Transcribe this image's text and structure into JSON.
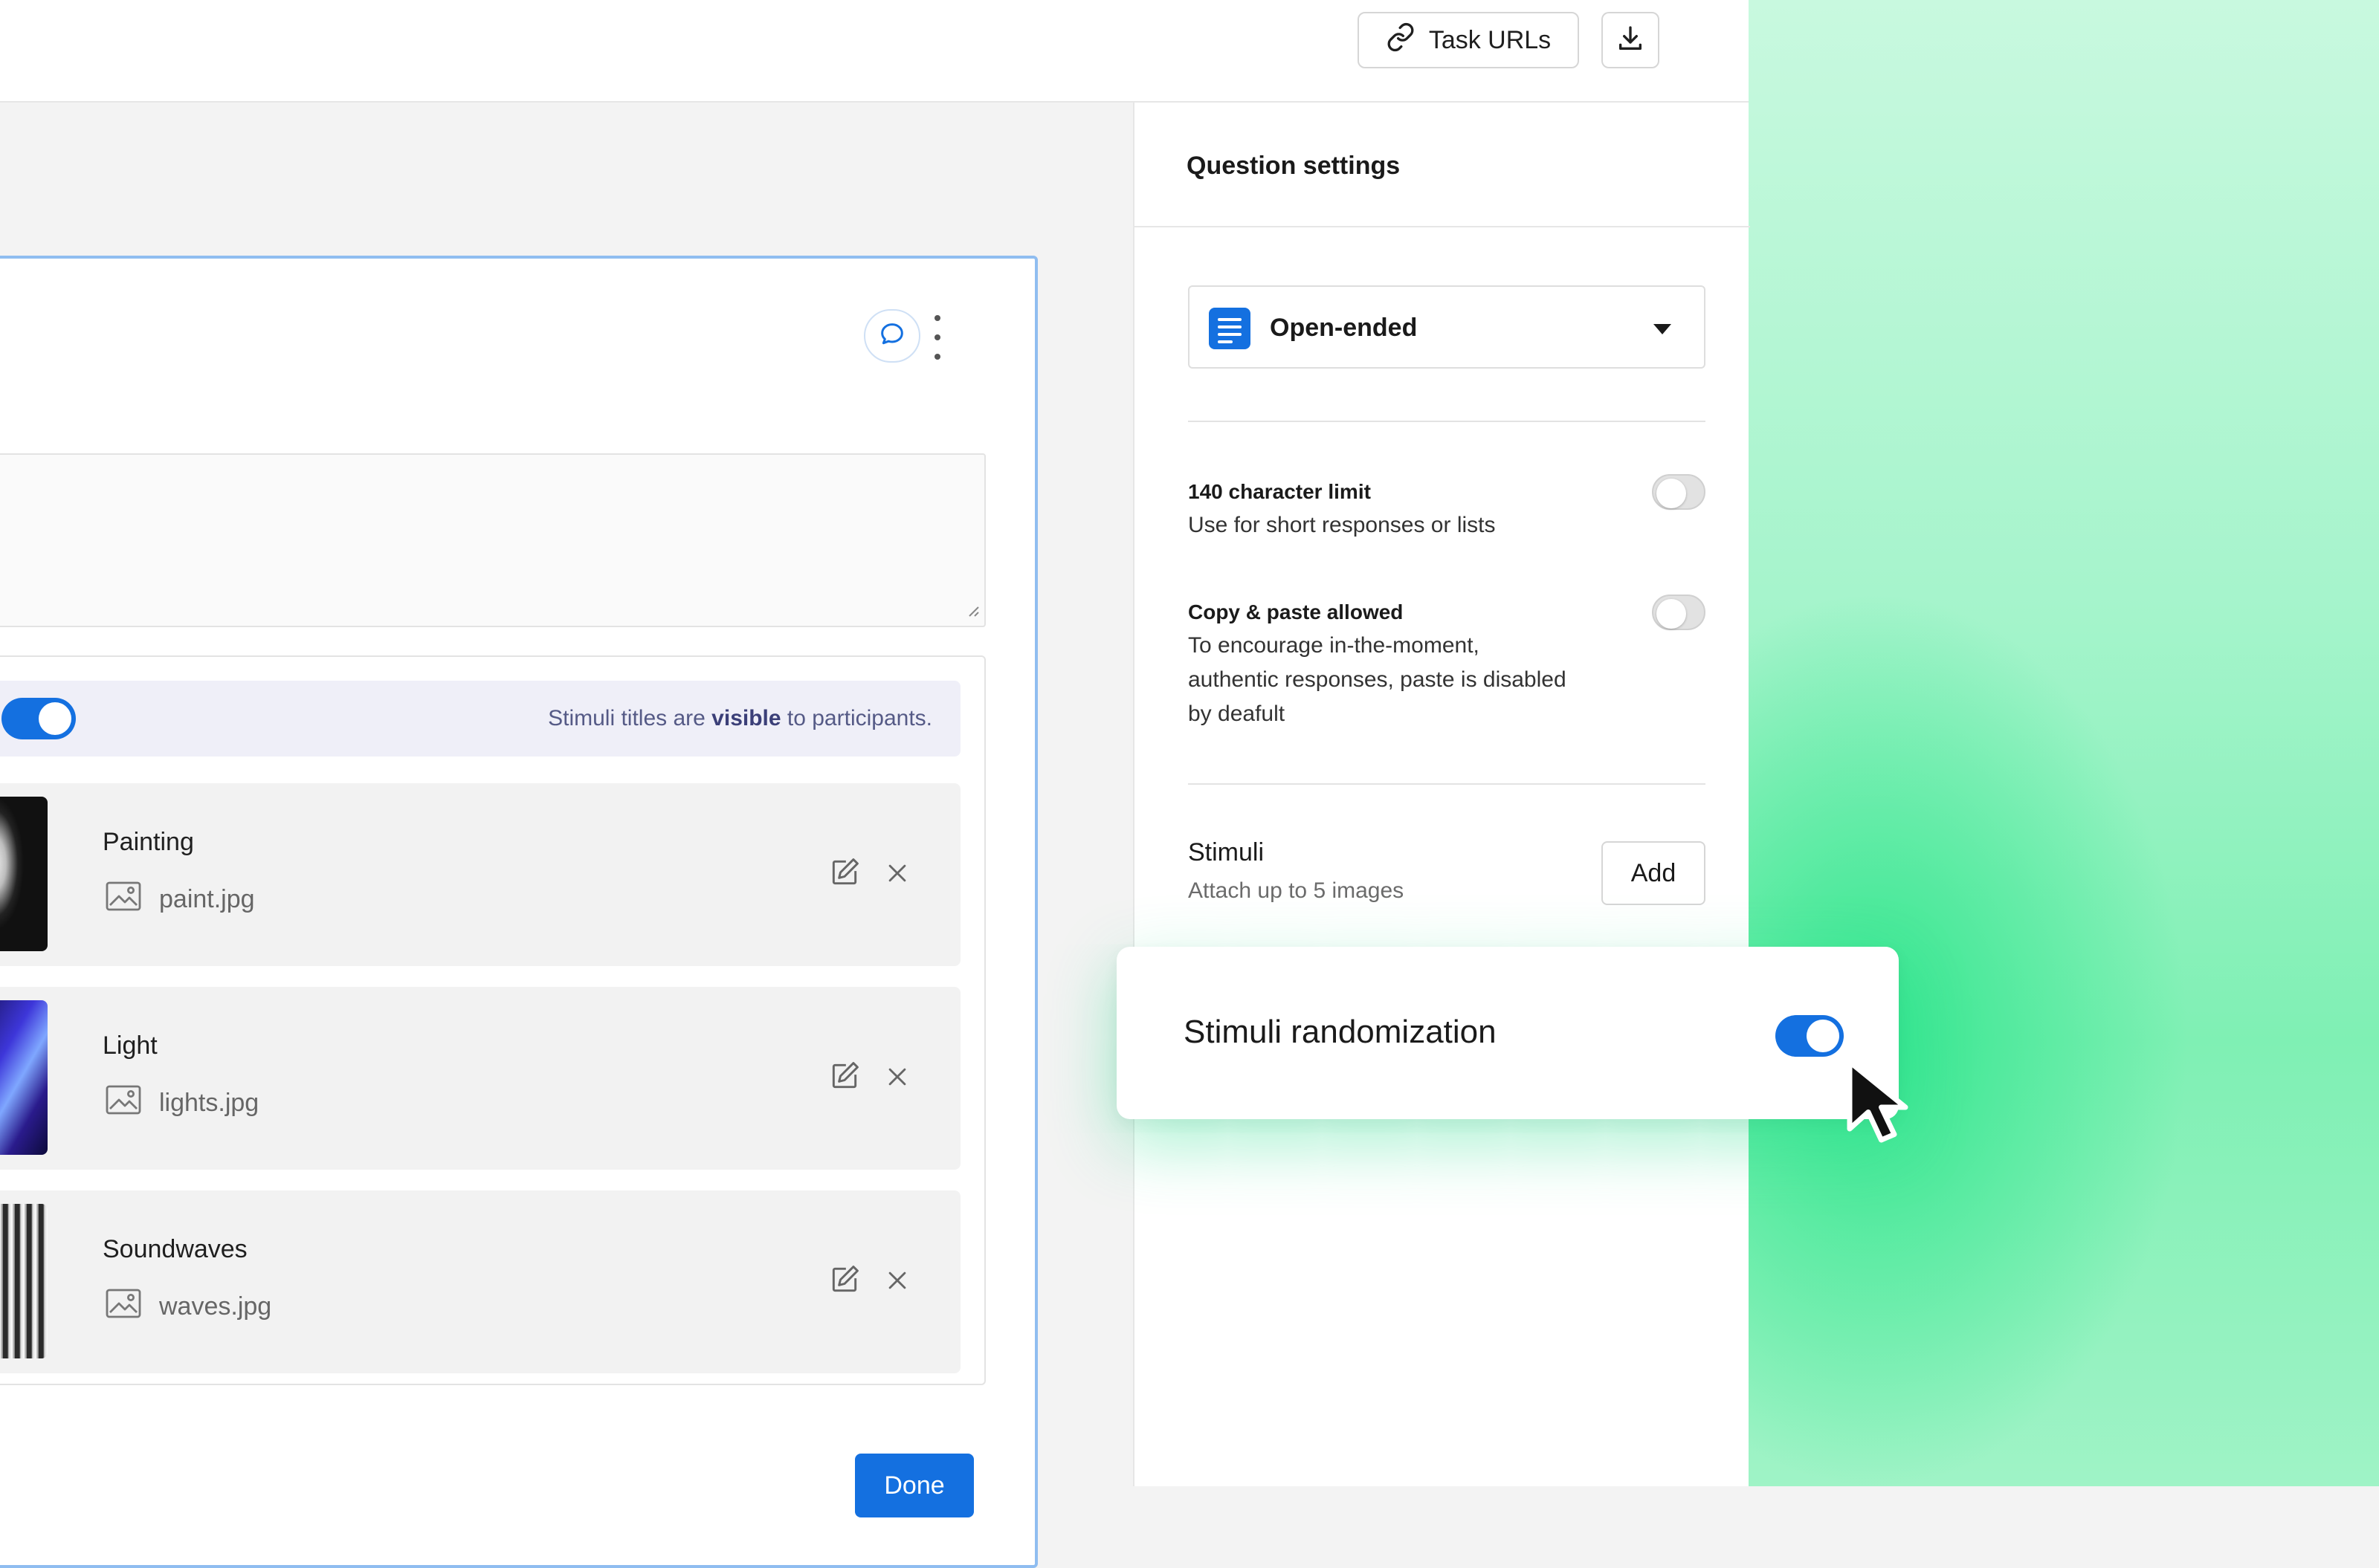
{
  "header": {
    "task_urls_label": "Task URLs"
  },
  "question_card": {
    "stimuli_visibility_text_1": "Stimuli titles are ",
    "stimuli_visibility_bold": "visible",
    "stimuli_visibility_text_2": " to participants.",
    "stimuli_visibility_toggle_on": true,
    "stimuli": [
      {
        "title": "Painting",
        "file": "paint.jpg"
      },
      {
        "title": "Light",
        "file": "lights.jpg"
      },
      {
        "title": "Soundwaves",
        "file": "waves.jpg"
      }
    ],
    "done_label": "Done"
  },
  "settings": {
    "title": "Question settings",
    "question_type": "Open-ended",
    "char_limit": {
      "title": "140 character limit",
      "desc": "Use for short responses or lists",
      "enabled": false
    },
    "copy_paste": {
      "title": "Copy & paste allowed",
      "desc": "To encourage in-the-moment, authentic responses, paste is disabled by deafult",
      "enabled": false
    },
    "stimuli": {
      "title": "Stimuli",
      "subtitle": "Attach up to 5 images",
      "add_label": "Add"
    },
    "randomization": {
      "title": "Stimuli randomization",
      "enabled": true
    }
  },
  "colors": {
    "accent": "#1470e0",
    "highlight": "#34e68f"
  }
}
